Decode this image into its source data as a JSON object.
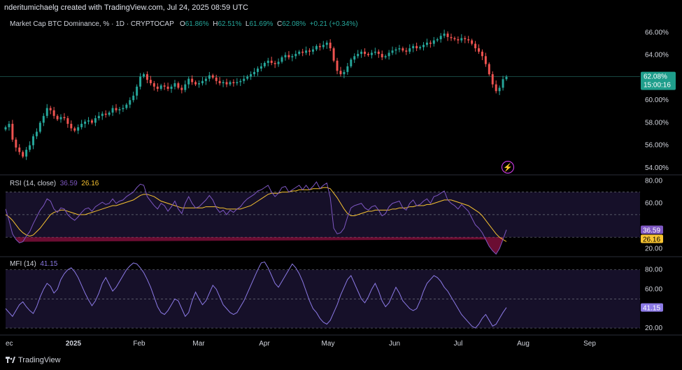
{
  "header": {
    "title": "nderitumichaelg created with TradingView.com, Jul 24, 2025 08:59 UTC"
  },
  "footer": {
    "brand": "TradingView"
  },
  "main_legend": {
    "name": "Market Cap BTC Dominance, %",
    "interval": "1D",
    "source": "CRYPTOCAP",
    "open_label": "O",
    "open": "61.86%",
    "high_label": "H",
    "high": "62.51%",
    "low_label": "L",
    "low": "61.69%",
    "close_label": "C",
    "close": "62.08%",
    "change": "+0.21 (+0.34%)"
  },
  "rsi_legend": {
    "name": "RSI (14, close)",
    "rsi_value": "36.59",
    "ma_value": "26.16"
  },
  "mfi_legend": {
    "name": "MFI (14)",
    "value": "41.15"
  },
  "price_tag": {
    "value": "62.08%",
    "countdown": "15:00:16"
  },
  "colors": {
    "up": "#26a69a",
    "down": "#ef5350",
    "rsi": "#7e57c2",
    "rsi_ma": "#f7c331",
    "mfi": "#8c7ae6",
    "band": "#1a1330",
    "price_tag": "#1f9e8c",
    "alert": "#e040fb"
  },
  "alert_icon": "lightning-icon",
  "chart_data": [
    {
      "type": "candlestick",
      "title": "Market Cap BTC Dominance, %",
      "x_ticks": [
        "ec",
        "2025",
        "Feb",
        "Mar",
        "Apr",
        "May",
        "Jun",
        "Jul",
        "Aug",
        "Sep"
      ],
      "y_ticks": [
        "66.00%",
        "64.00%",
        "62.00%",
        "60.00%",
        "58.00%",
        "56.00%",
        "54.00%"
      ],
      "ylim": [
        53.5,
        66.4
      ],
      "grid": false,
      "close_series": [
        57.6,
        57.9,
        56.5,
        55.8,
        55.4,
        55.0,
        55.6,
        56.0,
        56.8,
        57.2,
        58.0,
        58.6,
        59.3,
        59.1,
        58.6,
        58.3,
        58.5,
        58.4,
        57.9,
        57.5,
        57.3,
        57.6,
        57.9,
        58.1,
        58.2,
        58.0,
        58.4,
        58.6,
        58.8,
        58.7,
        58.9,
        59.3,
        59.1,
        59.2,
        59.3,
        59.6,
        60.0,
        60.4,
        61.2,
        62.1,
        62.3,
        61.8,
        61.5,
        61.2,
        61.0,
        61.3,
        61.2,
        61.0,
        61.2,
        61.5,
        61.1,
        60.9,
        61.4,
        61.9,
        61.6,
        61.4,
        61.5,
        61.7,
        61.9,
        62.2,
        62.0,
        61.7,
        61.5,
        61.6,
        61.4,
        61.6,
        61.5,
        61.6,
        61.7,
        61.9,
        62.1,
        62.3,
        62.5,
        62.8,
        63.0,
        63.3,
        63.5,
        63.3,
        63.2,
        63.4,
        63.8,
        64.0,
        63.8,
        63.9,
        64.1,
        64.3,
        64.2,
        64.4,
        64.3,
        64.5,
        64.8,
        64.7,
        64.9,
        65.1,
        64.6,
        63.5,
        62.6,
        62.3,
        62.5,
        63.0,
        63.6,
        63.9,
        64.1,
        64.3,
        64.1,
        64.0,
        64.2,
        64.3,
        64.1,
        63.8,
        63.9,
        64.2,
        64.4,
        64.5,
        64.6,
        64.4,
        64.3,
        64.6,
        64.8,
        64.6,
        64.7,
        64.9,
        65.1,
        65.0,
        65.3,
        65.4,
        65.7,
        65.9,
        65.6,
        65.5,
        65.4,
        65.3,
        65.5,
        65.4,
        65.3,
        65.0,
        64.6,
        64.3,
        63.9,
        63.2,
        62.3,
        61.4,
        60.8,
        61.1,
        61.86,
        62.08
      ],
      "last_close": 62.08
    },
    {
      "type": "line",
      "title": "RSI (14, close)",
      "y_ticks": [
        "80.00",
        "60.00",
        "20.00"
      ],
      "ylim": [
        14,
        84
      ],
      "bands": [
        30,
        50,
        70
      ],
      "series": [
        {
          "name": "RSI",
          "values": [
            55,
            45,
            33,
            28,
            25,
            26,
            31,
            35,
            42,
            48,
            54,
            58,
            64,
            62,
            55,
            52,
            56,
            55,
            50,
            47,
            45,
            48,
            52,
            55,
            56,
            53,
            57,
            59,
            61,
            59,
            60,
            64,
            60,
            62,
            63,
            66,
            68,
            70,
            74,
            77,
            76,
            66,
            62,
            58,
            55,
            60,
            58,
            53,
            57,
            62,
            55,
            51,
            60,
            66,
            60,
            56,
            57,
            60,
            63,
            67,
            63,
            56,
            52,
            54,
            50,
            54,
            52,
            55,
            57,
            61,
            64,
            66,
            68,
            71,
            72,
            74,
            76,
            70,
            66,
            69,
            74,
            75,
            70,
            72,
            74,
            76,
            72,
            76,
            72,
            75,
            79,
            73,
            76,
            78,
            65,
            38,
            33,
            34,
            38,
            48,
            56,
            58,
            59,
            60,
            56,
            54,
            57,
            58,
            54,
            49,
            51,
            57,
            60,
            61,
            62,
            56,
            54,
            60,
            63,
            58,
            59,
            62,
            64,
            60,
            66,
            67,
            69,
            71,
            63,
            60,
            58,
            55,
            59,
            56,
            53,
            47,
            41,
            38,
            34,
            28,
            22,
            18,
            15,
            20,
            28,
            36.59
          ]
        },
        {
          "name": "RSI-based MA",
          "values": [
            50,
            48,
            45,
            41,
            37,
            34,
            32,
            31,
            32,
            35,
            38,
            42,
            46,
            50,
            52,
            53,
            54,
            54,
            53,
            52,
            51,
            50,
            50,
            50,
            51,
            52,
            53,
            54,
            55,
            56,
            57,
            58,
            58,
            59,
            60,
            61,
            62,
            63,
            65,
            67,
            68,
            68,
            67,
            66,
            64,
            62,
            61,
            60,
            59,
            58,
            57,
            56,
            56,
            56,
            56,
            56,
            56,
            56,
            57,
            57,
            57,
            57,
            56,
            56,
            55,
            55,
            55,
            55,
            55,
            56,
            57,
            58,
            60,
            62,
            64,
            66,
            68,
            69,
            69,
            69,
            70,
            70,
            70,
            71,
            71,
            72,
            72,
            72,
            72,
            73,
            73,
            73,
            74,
            74,
            73,
            69,
            65,
            60,
            55,
            51,
            49,
            49,
            50,
            51,
            52,
            53,
            53,
            54,
            54,
            54,
            54,
            54,
            55,
            55,
            56,
            56,
            56,
            57,
            57,
            58,
            58,
            58,
            59,
            59,
            60,
            61,
            62,
            63,
            63,
            63,
            62,
            61,
            60,
            59,
            58,
            56,
            54,
            52,
            49,
            45,
            41,
            37,
            33,
            30,
            28,
            26.16
          ]
        }
      ],
      "last_rsi": 36.59,
      "last_ma": 26.16
    },
    {
      "type": "line",
      "title": "MFI (14)",
      "y_ticks": [
        "80.00",
        "60.00",
        "20.00"
      ],
      "ylim": [
        15,
        92
      ],
      "bands": [
        20,
        50,
        80
      ],
      "series": [
        {
          "name": "MFI",
          "values": [
            40,
            36,
            32,
            38,
            44,
            47,
            42,
            38,
            35,
            42,
            52,
            60,
            66,
            63,
            56,
            60,
            70,
            76,
            80,
            82,
            78,
            72,
            64,
            56,
            49,
            43,
            48,
            56,
            66,
            72,
            65,
            58,
            62,
            68,
            74,
            80,
            84,
            87,
            86,
            82,
            77,
            70,
            62,
            52,
            42,
            36,
            34,
            38,
            44,
            50,
            48,
            40,
            32,
            36,
            48,
            57,
            50,
            44,
            48,
            56,
            64,
            60,
            52,
            44,
            40,
            36,
            34,
            36,
            42,
            48,
            56,
            64,
            72,
            80,
            87,
            88,
            82,
            74,
            66,
            62,
            68,
            74,
            80,
            86,
            82,
            76,
            68,
            58,
            48,
            40,
            36,
            30,
            26,
            24,
            28,
            36,
            44,
            54,
            62,
            70,
            74,
            66,
            58,
            50,
            46,
            52,
            60,
            66,
            58,
            48,
            42,
            46,
            54,
            62,
            56,
            48,
            44,
            40,
            38,
            40,
            48,
            58,
            66,
            70,
            74,
            72,
            68,
            62,
            58,
            52,
            46,
            40,
            34,
            30,
            26,
            22,
            20,
            24,
            30,
            34,
            28,
            22,
            24,
            30,
            36,
            41.15
          ]
        }
      ],
      "last_mfi": 41.15
    }
  ]
}
